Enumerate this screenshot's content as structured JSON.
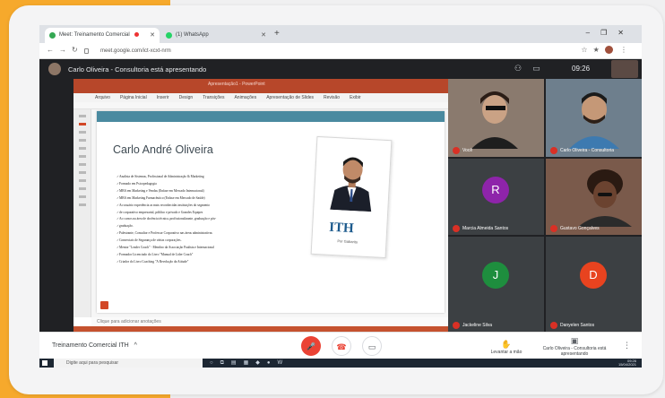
{
  "browser": {
    "tabs": [
      {
        "label": "Meet: Treinamento Comercial",
        "active": true,
        "favicon_color": "#34a853"
      },
      {
        "label": "(1) WhatsApp",
        "active": false,
        "favicon_color": "#25d366"
      }
    ],
    "new_tab": "+",
    "window_controls": [
      "–",
      "❐",
      "✕"
    ],
    "nav": [
      "←",
      "→",
      "↻"
    ],
    "url": "meet.google.com/ict-xcxt-nrm",
    "right_icons": [
      "☆",
      "★",
      "⋮"
    ]
  },
  "meet": {
    "presenter_banner": "Carlo Oliveira - Consultoria está apresentando",
    "top_icons": [
      "people-icon",
      "chat-icon"
    ],
    "time": "09:26",
    "meeting_title": "Treinamento Comercial ITH",
    "expand_glyph": "^",
    "controls": {
      "mic_glyph": "🎤",
      "hangup_glyph": "☎",
      "camera_glyph": "▭"
    },
    "actions": [
      {
        "icon": "✋",
        "label": "Levantar a mão"
      },
      {
        "icon": "▣",
        "label": "Carlo Oliveira - Consultoria está apresentando"
      }
    ],
    "more_glyph": "⋮"
  },
  "presentation": {
    "app_title": "Apresentação1 - PowerPoint",
    "menu": [
      "Arquivo",
      "Página Inicial",
      "Inserir",
      "Design",
      "Transições",
      "Animações",
      "Apresentação de Slides",
      "Revisão",
      "Exibir"
    ],
    "slide_name": "Carlo André Oliveira",
    "bullets": [
      "Analista de Sistemas, Profissional de Administração & Marketing",
      "Formado em Psicopedagogia",
      "MBA em Marketing e Vendas (Enfase em Mercado Internacional)",
      "MBA em Marketing Farmacêutico (Enfase em Mercado de Saúde)",
      "Ao usuário experiência as mais reconhecidas instituições do segmento",
      "de corporativo empresarial, público e privado e Grandes Equipes",
      "Ao cursos na área de docência técnica, profissionalizante, graduação e pós-",
      "graduação.",
      "Palestrante, Consultor e Professor Corporativo nas áreas administrativas",
      "Comerciais de Segurança de várias corporações.",
      "Mentor \"Leader Coach\" - Membro da Associação Paulista e Internacional",
      "Formador Licenciado do Livro \"Manual de Lider Coach\"",
      "Criador do Livro Coaching \"A Revolução da Atitude\""
    ],
    "logo": "ITH",
    "logo_subtitle": "Por Gabarito",
    "notes_placeholder": "Clique para adicionar anotações"
  },
  "participants": [
    {
      "name": "Você",
      "kind": "video",
      "bg": "#8a7a6e"
    },
    {
      "name": "Carlo Oliveira - Consultoria",
      "kind": "video",
      "bg": "#6e7f8d"
    },
    {
      "name": "Marcia Almeida Santos",
      "kind": "initial",
      "initial": "R",
      "color": "#8e24aa"
    },
    {
      "name": "Gustavo Gonçalves",
      "kind": "video",
      "bg": "#7a5a4b"
    },
    {
      "name": "Jackeline Silva",
      "kind": "initial",
      "initial": "J",
      "color": "#1e8e3e"
    },
    {
      "name": "Danyelen Santos",
      "kind": "initial",
      "initial": "D",
      "color": "#e8431f"
    }
  ],
  "taskbar": {
    "search_placeholder": "Digite aqui para pesquisar",
    "apps": [
      "○",
      "⧉",
      "▤",
      "▦",
      "◆",
      "●",
      "W"
    ],
    "tray_time": "09:26",
    "tray_date": "15/04/2021"
  }
}
